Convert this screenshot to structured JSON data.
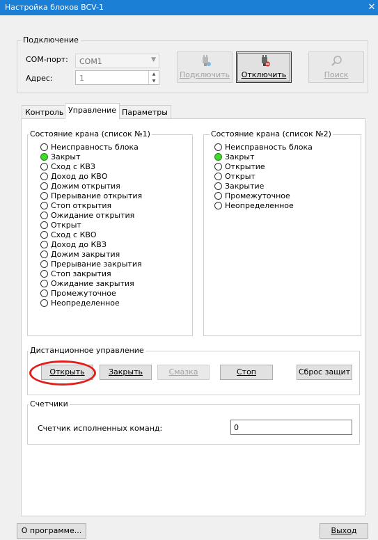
{
  "window": {
    "title": "Настройка блоков BCV-1",
    "close_glyph": "✕"
  },
  "connection": {
    "legend": "Подключение",
    "com_label": "COM-порт:",
    "com_value": "COM1",
    "address_label": "Адрес:",
    "address_value": "1",
    "connect_label": "Подключить",
    "disconnect_label": "Отключить",
    "search_label": "Поиск"
  },
  "tabs": [
    {
      "label": "Контроль"
    },
    {
      "label": "Управление",
      "active": true
    },
    {
      "label": "Параметры"
    }
  ],
  "list1": {
    "legend": "Состояние крана (список №1)",
    "items": [
      {
        "label": "Неисправность блока",
        "on": false
      },
      {
        "label": "Закрыт",
        "on": true
      },
      {
        "label": "Сход с КВЗ",
        "on": false
      },
      {
        "label": "Доход до КВО",
        "on": false
      },
      {
        "label": "Дожим открытия",
        "on": false
      },
      {
        "label": "Прерывание открытия",
        "on": false
      },
      {
        "label": "Стоп открытия",
        "on": false
      },
      {
        "label": "Ожидание открытия",
        "on": false
      },
      {
        "label": "Открыт",
        "on": false
      },
      {
        "label": "Сход с КВО",
        "on": false
      },
      {
        "label": "Доход до КВЗ",
        "on": false
      },
      {
        "label": "Дожим закрытия",
        "on": false
      },
      {
        "label": "Прерывание закрытия",
        "on": false
      },
      {
        "label": "Стоп закрытия",
        "on": false
      },
      {
        "label": "Ожидание закрытия",
        "on": false
      },
      {
        "label": "Промежуточное",
        "on": false
      },
      {
        "label": "Неопределенное",
        "on": false
      }
    ]
  },
  "list2": {
    "legend": "Состояние крана (список №2)",
    "items": [
      {
        "label": "Неисправность блока",
        "on": false
      },
      {
        "label": "Закрыт",
        "on": true
      },
      {
        "label": "Открытие",
        "on": false
      },
      {
        "label": "Открыт",
        "on": false
      },
      {
        "label": "Закрытие",
        "on": false
      },
      {
        "label": "Промежуточное",
        "on": false
      },
      {
        "label": "Неопределенное",
        "on": false
      }
    ]
  },
  "remote": {
    "legend": "Дистанционное управление",
    "open_label": "Открыть",
    "close_label": "Закрыть",
    "lube_label": "Смазка",
    "stop_label": "Стоп",
    "reset_label": "Сброс защит"
  },
  "counters": {
    "legend": "Счетчики",
    "executed_label": "Счетчик исполненных команд:",
    "executed_value": "0"
  },
  "footer": {
    "about_label": "О программе...",
    "exit_label": "Выход"
  },
  "colors": {
    "title_bar": "#1c7fd6",
    "indicator_on": "#3ddc2a",
    "highlight_circle": "#e2201b"
  }
}
